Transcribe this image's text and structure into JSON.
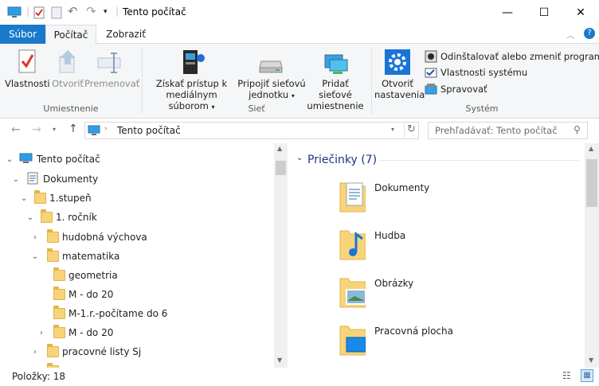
{
  "window": {
    "title": "Tento počítač",
    "minimize": "—",
    "maximize": "☐",
    "close": "✕"
  },
  "tabs": {
    "file": "Súbor",
    "computer": "Počítač",
    "view": "Zobraziť"
  },
  "ribbon": {
    "location": {
      "properties": "Vlastnosti",
      "open": "Otvoriť",
      "rename": "Premenovať",
      "group": "Umiestnenie"
    },
    "network": {
      "media_line1": "Získať prístup k",
      "media_line2": "mediálnym súborom",
      "map_line1": "Pripojiť sieťovú",
      "map_line2": "jednotku",
      "add_line1": "Pridať sieťové",
      "add_line2": "umiestnenie",
      "group": "Sieť"
    },
    "system": {
      "settings_line1": "Otvoriť",
      "settings_line2": "nastavenia",
      "uninstall": "Odinštalovať alebo zmeniť program",
      "sysprops": "Vlastnosti systému",
      "manage": "Spravovať",
      "group": "Systém"
    }
  },
  "nav": {
    "address": "Tento počítač",
    "search_placeholder": "Prehľadávať: Tento počítač"
  },
  "tree": {
    "items": [
      {
        "label": "Tento počítač"
      },
      {
        "label": "Dokumenty"
      },
      {
        "label": "1.stupeň"
      },
      {
        "label": "1. ročník"
      },
      {
        "label": "hudobná výchova"
      },
      {
        "label": "matematika"
      },
      {
        "label": "geometria"
      },
      {
        "label": "M - do 20"
      },
      {
        "label": "M-1.r.-počítame do 6"
      },
      {
        "label": "M - do 20"
      },
      {
        "label": "pracovné listy Sj"
      }
    ]
  },
  "content": {
    "group_header": "Priečinky (7)",
    "folders": [
      {
        "label": "Dokumenty"
      },
      {
        "label": "Hudba"
      },
      {
        "label": "Obrázky"
      },
      {
        "label": "Pracovná plocha"
      }
    ]
  },
  "status": {
    "count": "Položky: 18"
  },
  "colors": {
    "accent": "#1979ca",
    "folder": "#f7d37a",
    "header_blue": "#1e3287"
  }
}
